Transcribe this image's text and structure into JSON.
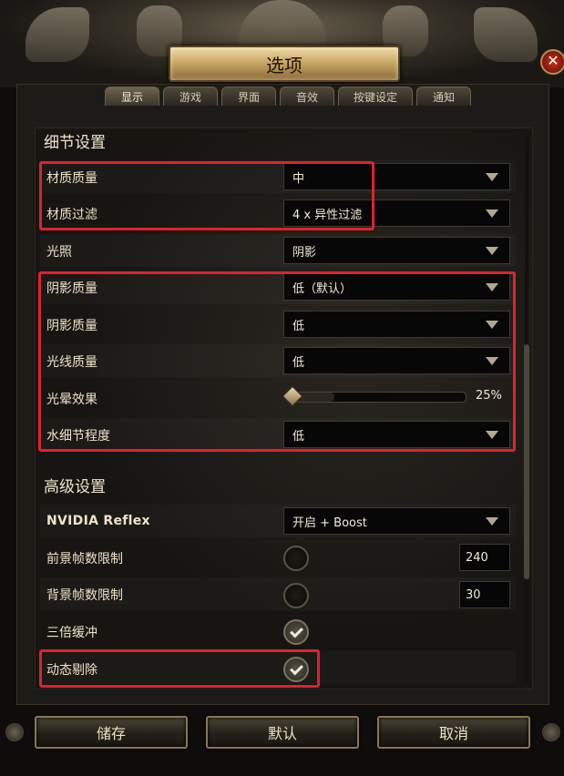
{
  "window": {
    "title": "选项",
    "close_glyph": "✕"
  },
  "tabs": [
    {
      "label": "显示",
      "active": true
    },
    {
      "label": "游戏",
      "active": false
    },
    {
      "label": "界面",
      "active": false
    },
    {
      "label": "音效",
      "active": false
    },
    {
      "label": "按键设定",
      "active": false
    },
    {
      "label": "通知",
      "active": false
    }
  ],
  "detail_section": {
    "title": "细节设置",
    "rows": [
      {
        "label": "材质质量",
        "value": "中"
      },
      {
        "label": "材质过滤",
        "value": "4 x 异性过滤"
      },
      {
        "label": "光照",
        "value": "阴影"
      },
      {
        "label": "阴影质量",
        "value": "低（默认）"
      },
      {
        "label": "阴影质量",
        "value": "低"
      },
      {
        "label": "光线质量",
        "value": "低"
      },
      {
        "label": "光晕效果",
        "slider_percent": 25,
        "value_text": "25%"
      },
      {
        "label": "水细节程度",
        "value": "低"
      }
    ]
  },
  "advanced_section": {
    "title": "高级设置",
    "rows": [
      {
        "label": "NVIDIA Reflex",
        "value": "开启 + Boost"
      },
      {
        "label": "前景帧数限制",
        "enabled": false,
        "number": "240"
      },
      {
        "label": "背景帧数限制",
        "enabled": false,
        "number": "30"
      },
      {
        "label": "三倍缓冲",
        "checked": true
      },
      {
        "label": "动态剔除",
        "checked": true
      }
    ]
  },
  "buttons": {
    "save": "储存",
    "default": "默认",
    "cancel": "取消"
  },
  "colors": {
    "highlight": "#e0222b",
    "accent_gold": "#c9a866"
  }
}
